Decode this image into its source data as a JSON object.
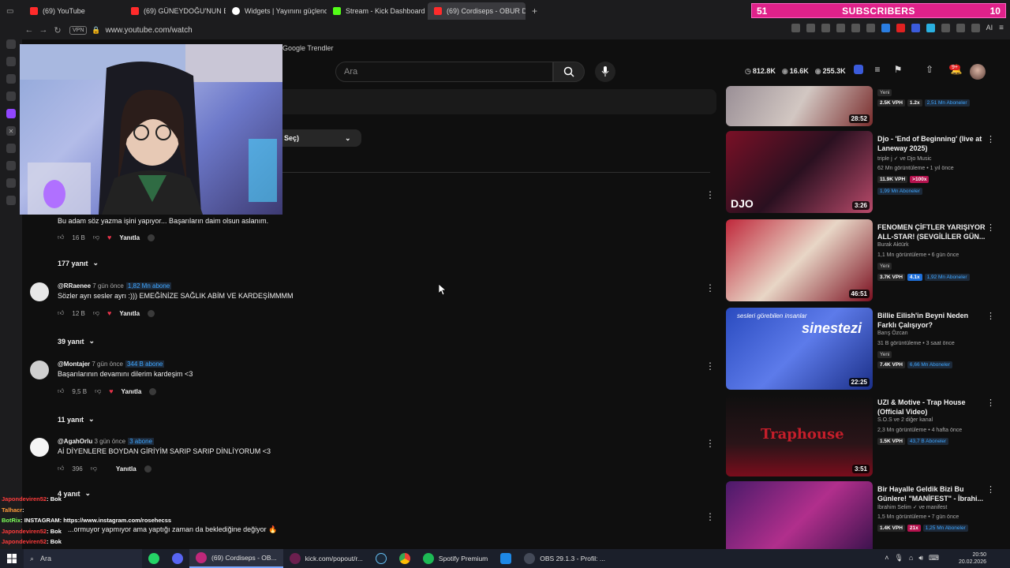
{
  "browser": {
    "tabs": [
      {
        "label": "(69) YouTube",
        "color": "#ff2b2b",
        "active": false
      },
      {
        "label": "(69) GÜNEYDOĞU'NUN E",
        "color": "#ff2b2b",
        "active": false
      },
      {
        "label": "Widgets | Yayınını güçlend",
        "color": "#ffffff",
        "active": false
      },
      {
        "label": "Stream - Kick Dashboard",
        "color": "#53fc18",
        "active": false
      },
      {
        "label": "(69) Cordiseps - OBUR DE",
        "color": "#ff2b2b",
        "active": true
      }
    ],
    "new_tab": "+",
    "url": "www.youtube.com/watch",
    "vpn": "VPN",
    "bookmark": "Google Trendler",
    "ai_label": "AI"
  },
  "subscriber_banner": {
    "left": "51",
    "label": "SUBSCRIBERS",
    "right": "10"
  },
  "youtube": {
    "search_placeholder": "Ara",
    "stats": [
      "812.8K",
      "16.6K",
      "255.3K"
    ],
    "notif_count": "9+",
    "sort_label": "Seç)",
    "comments": [
      {
        "text": "Bu adam söz yazma işini yapıyor... Başarıların daim olsun aslanım.",
        "likes": "16 B",
        "reply": "Yanıtla",
        "replies": "177 yanıt"
      },
      {
        "user": "@RRaenee",
        "time": "7 gün önce",
        "subs": "1,82 Mn abone",
        "text": "Sözler ayrı sesler ayrı :))) EMEĞİNİZE SAĞLIK ABİM VE KARDEŞİMMMM",
        "likes": "12 B",
        "reply": "Yanıtla",
        "replies": "39 yanıt"
      },
      {
        "user": "@Montajer",
        "time": "7 gün önce",
        "subs": "344 B abone",
        "text": "Başarılarının devamını dilerim kardeşim <3",
        "likes": "9,5 B",
        "reply": "Yanıtla",
        "replies": "11 yanıt"
      },
      {
        "user": "@AgahOrlu",
        "time": "3 gün önce",
        "subs": "3 abone",
        "text": "Aİ DİYENLERE BOYDAN GİRİYİM SARIP SARIP DİNLİYORUM <3",
        "likes": "396",
        "reply": "Yanıtla",
        "replies": "4 yanıt"
      },
      {
        "text": "...ormuyor yapmıyor ama yaptığı zaman da beklediğine değiyor 🔥",
        "reply": "Yanıtla"
      }
    ],
    "recommendations": [
      {
        "title": "",
        "new": "Yeni",
        "vph": "2.5K VPH",
        "mult": "1.2x",
        "subs": "2,51 Mn Aboneler",
        "duration": "28:52",
        "colors": [
          "#9a8f96",
          "#d2c7c2",
          "#7a2d2d"
        ]
      },
      {
        "title": "Djo - 'End of Beginning' (live at Laneway 2025)",
        "channel": "triple j ✓ ve Djo Music",
        "meta": "62 Mn görüntüleme • 1 yıl önce",
        "vph": "11.9K VPH",
        "mult": ">100x",
        "subs": "1,99 Mn Aboneler",
        "duration": "3:26",
        "thumb_text": "DJO",
        "colors": [
          "#7a1026",
          "#2a1020",
          "#b84a6a"
        ]
      },
      {
        "title": "FENOMEN ÇİFTLER YARIŞIYOR ALL-STAR! (SEVGİLİLER GÜN...",
        "channel": "Burak Aktürk",
        "meta": "1,1 Mn görüntüleme • 6 gün önce",
        "new": "Yeni",
        "vph": "3.7K VPH",
        "mult": "4.1x",
        "subs": "1,92 Mn Aboneler",
        "duration": "46:51",
        "colors": [
          "#c0283b",
          "#e8d6c6",
          "#7b1020"
        ]
      },
      {
        "title": "Billie Eilish'in Beyni Neden Farklı Çalışıyor?",
        "channel": "Barış Özcan",
        "meta": "31 B görüntüleme • 3 saat önce",
        "new": "Yeni",
        "vph": "7.4K VPH",
        "subs": "6,66 Mn Aboneler",
        "duration": "22:25",
        "thumb_text": "sinestezi",
        "thumb_sub": "sesleri görebilen insanlar",
        "colors": [
          "#2a4bbf",
          "#5d7bea",
          "#1b2f88"
        ]
      },
      {
        "title": "UZI & Motive - Trap House (Official Video)",
        "channel": "S.O.S ve 2 diğer kanal",
        "meta": "2,3 Mn görüntüleme • 4 hafta önce",
        "vph": "1.5K VPH",
        "subs": "43,7 B Aboneler",
        "duration": "3:51",
        "thumb_text": "Traphouse",
        "colors": [
          "#0f0f0f",
          "#2a1418",
          "#7a0d1c"
        ]
      },
      {
        "title": "Bir Hayalle Geldik Bizi Bu Günlere! \"MANİFEST\" - İbrahi...",
        "channel": "İbrahim Selim ✓ ve manifest",
        "meta": "1,5 Mn görüntüleme • 7 gün önce",
        "vph": "1.4K VPH",
        "mult": "21x",
        "subs": "1,25 Mn Aboneler",
        "colors": [
          "#4a1a6a",
          "#b12f8c",
          "#2c0f45"
        ]
      }
    ]
  },
  "chat": [
    {
      "user": "Japondeviren52",
      "msg": ": Bok",
      "cls": "u1"
    },
    {
      "user": "Talhacr",
      "msg": ":",
      "cls": "u2"
    },
    {
      "user": "BotRix",
      "msg": ": INSTAGRAM: https://www.instagram.com/rosehecss",
      "cls": "u3"
    },
    {
      "user": "Japondeviren52",
      "msg": ": Bok",
      "cls": "u1"
    },
    {
      "user": "Japondeviren52",
      "msg": ": Bok",
      "cls": "u1"
    }
  ],
  "taskbar": {
    "search": "Ara",
    "items": [
      {
        "label": "(69) Cordiseps - OB...",
        "color": "#c0287a",
        "active": true
      },
      {
        "label": "kick.com/popout/r...",
        "color": "#6b1f4e",
        "active": false
      },
      {
        "label": "Spotify Premium",
        "color": "#1db954",
        "active": false
      },
      {
        "label": "OBS 29.1.3 - Profil: ...",
        "color": "#444a58",
        "active": false
      }
    ],
    "time": "20:50",
    "date": "20.02.2026"
  }
}
